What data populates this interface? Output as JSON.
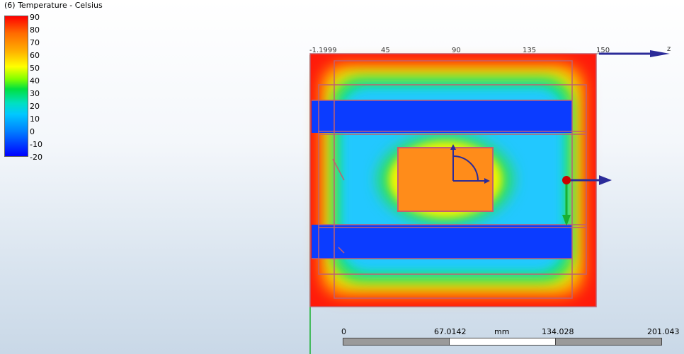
{
  "legend": {
    "title": "(6) Temperature - Celsius",
    "ticks": [
      "90",
      "80",
      "70",
      "60",
      "50",
      "40",
      "30",
      "20",
      "10",
      "0",
      "-10",
      "-20"
    ],
    "colors": [
      "#ff0000",
      "#ff6a00",
      "#ffb000",
      "#ffff00",
      "#7fff00",
      "#00e040",
      "#00e0c0",
      "#00c8ff",
      "#0080ff",
      "#0000ff"
    ]
  },
  "ruler": {
    "labels": [
      "-1.1999",
      "45",
      "90",
      "135",
      "150"
    ],
    "axis_label": "z"
  },
  "scale": {
    "labels": [
      "0",
      "67.0142",
      "mm",
      "134.028",
      "201.043"
    ]
  },
  "colors": {
    "hot": "#ff2010",
    "cold": "#0033ff",
    "insert": "#ff8c1a",
    "edge": "#c06070",
    "axis_blue": "#2b2b99",
    "axis_green": "#18b030",
    "origin": "#cc0000"
  }
}
